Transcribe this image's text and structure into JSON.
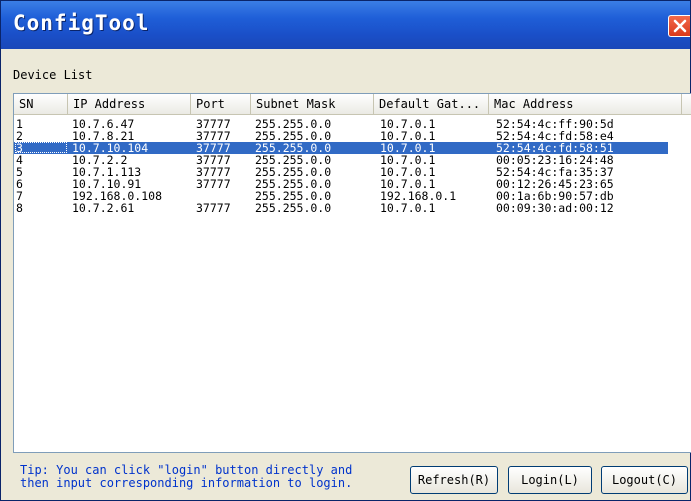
{
  "window": {
    "title": "ConfigTool"
  },
  "section": {
    "label": "Device List"
  },
  "table": {
    "columns": [
      "SN",
      "IP Address",
      "Port",
      "Subnet Mask",
      "Default Gat...",
      "Mac Address"
    ],
    "rows": [
      [
        "1",
        "10.7.6.47",
        "37777",
        "255.255.0.0",
        "10.7.0.1",
        "52:54:4c:ff:90:5d"
      ],
      [
        "2",
        "10.7.8.21",
        "37777",
        "255.255.0.0",
        "10.7.0.1",
        "52:54:4c:fd:58:e4"
      ],
      [
        "3",
        "10.7.10.104",
        "37777",
        "255.255.0.0",
        "10.7.0.1",
        "52:54:4c:fd:58:51"
      ],
      [
        "4",
        "10.7.2.2",
        "37777",
        "255.255.0.0",
        "10.7.0.1",
        "00:05:23:16:24:48"
      ],
      [
        "5",
        "10.7.1.113",
        "37777",
        "255.255.0.0",
        "10.7.0.1",
        "52:54:4c:fa:35:37"
      ],
      [
        "6",
        "10.7.10.91",
        "37777",
        "255.255.0.0",
        "10.7.0.1",
        "00:12:26:45:23:65"
      ],
      [
        "7",
        "192.168.0.108",
        "",
        "255.255.0.0",
        "192.168.0.1",
        "00:1a:6b:90:57:db"
      ],
      [
        "8",
        "10.7.2.61",
        "37777",
        "255.255.0.0",
        "10.7.0.1",
        "00:09:30:ad:00:12"
      ]
    ],
    "selected_row": 3
  },
  "tip": {
    "line1": "Tip: You can click \"login\" button directly and",
    "line2": "then input corresponding information to login."
  },
  "buttons": {
    "refresh": "Refresh(R)",
    "login": "Login(L)",
    "logout": "Logout(C)"
  },
  "icons": {
    "close": "close-icon"
  },
  "colors": {
    "titlebar": "#1f5fd8",
    "selection": "#316ac5",
    "tip_text": "#0033cc",
    "close_button": "#d9391c"
  }
}
